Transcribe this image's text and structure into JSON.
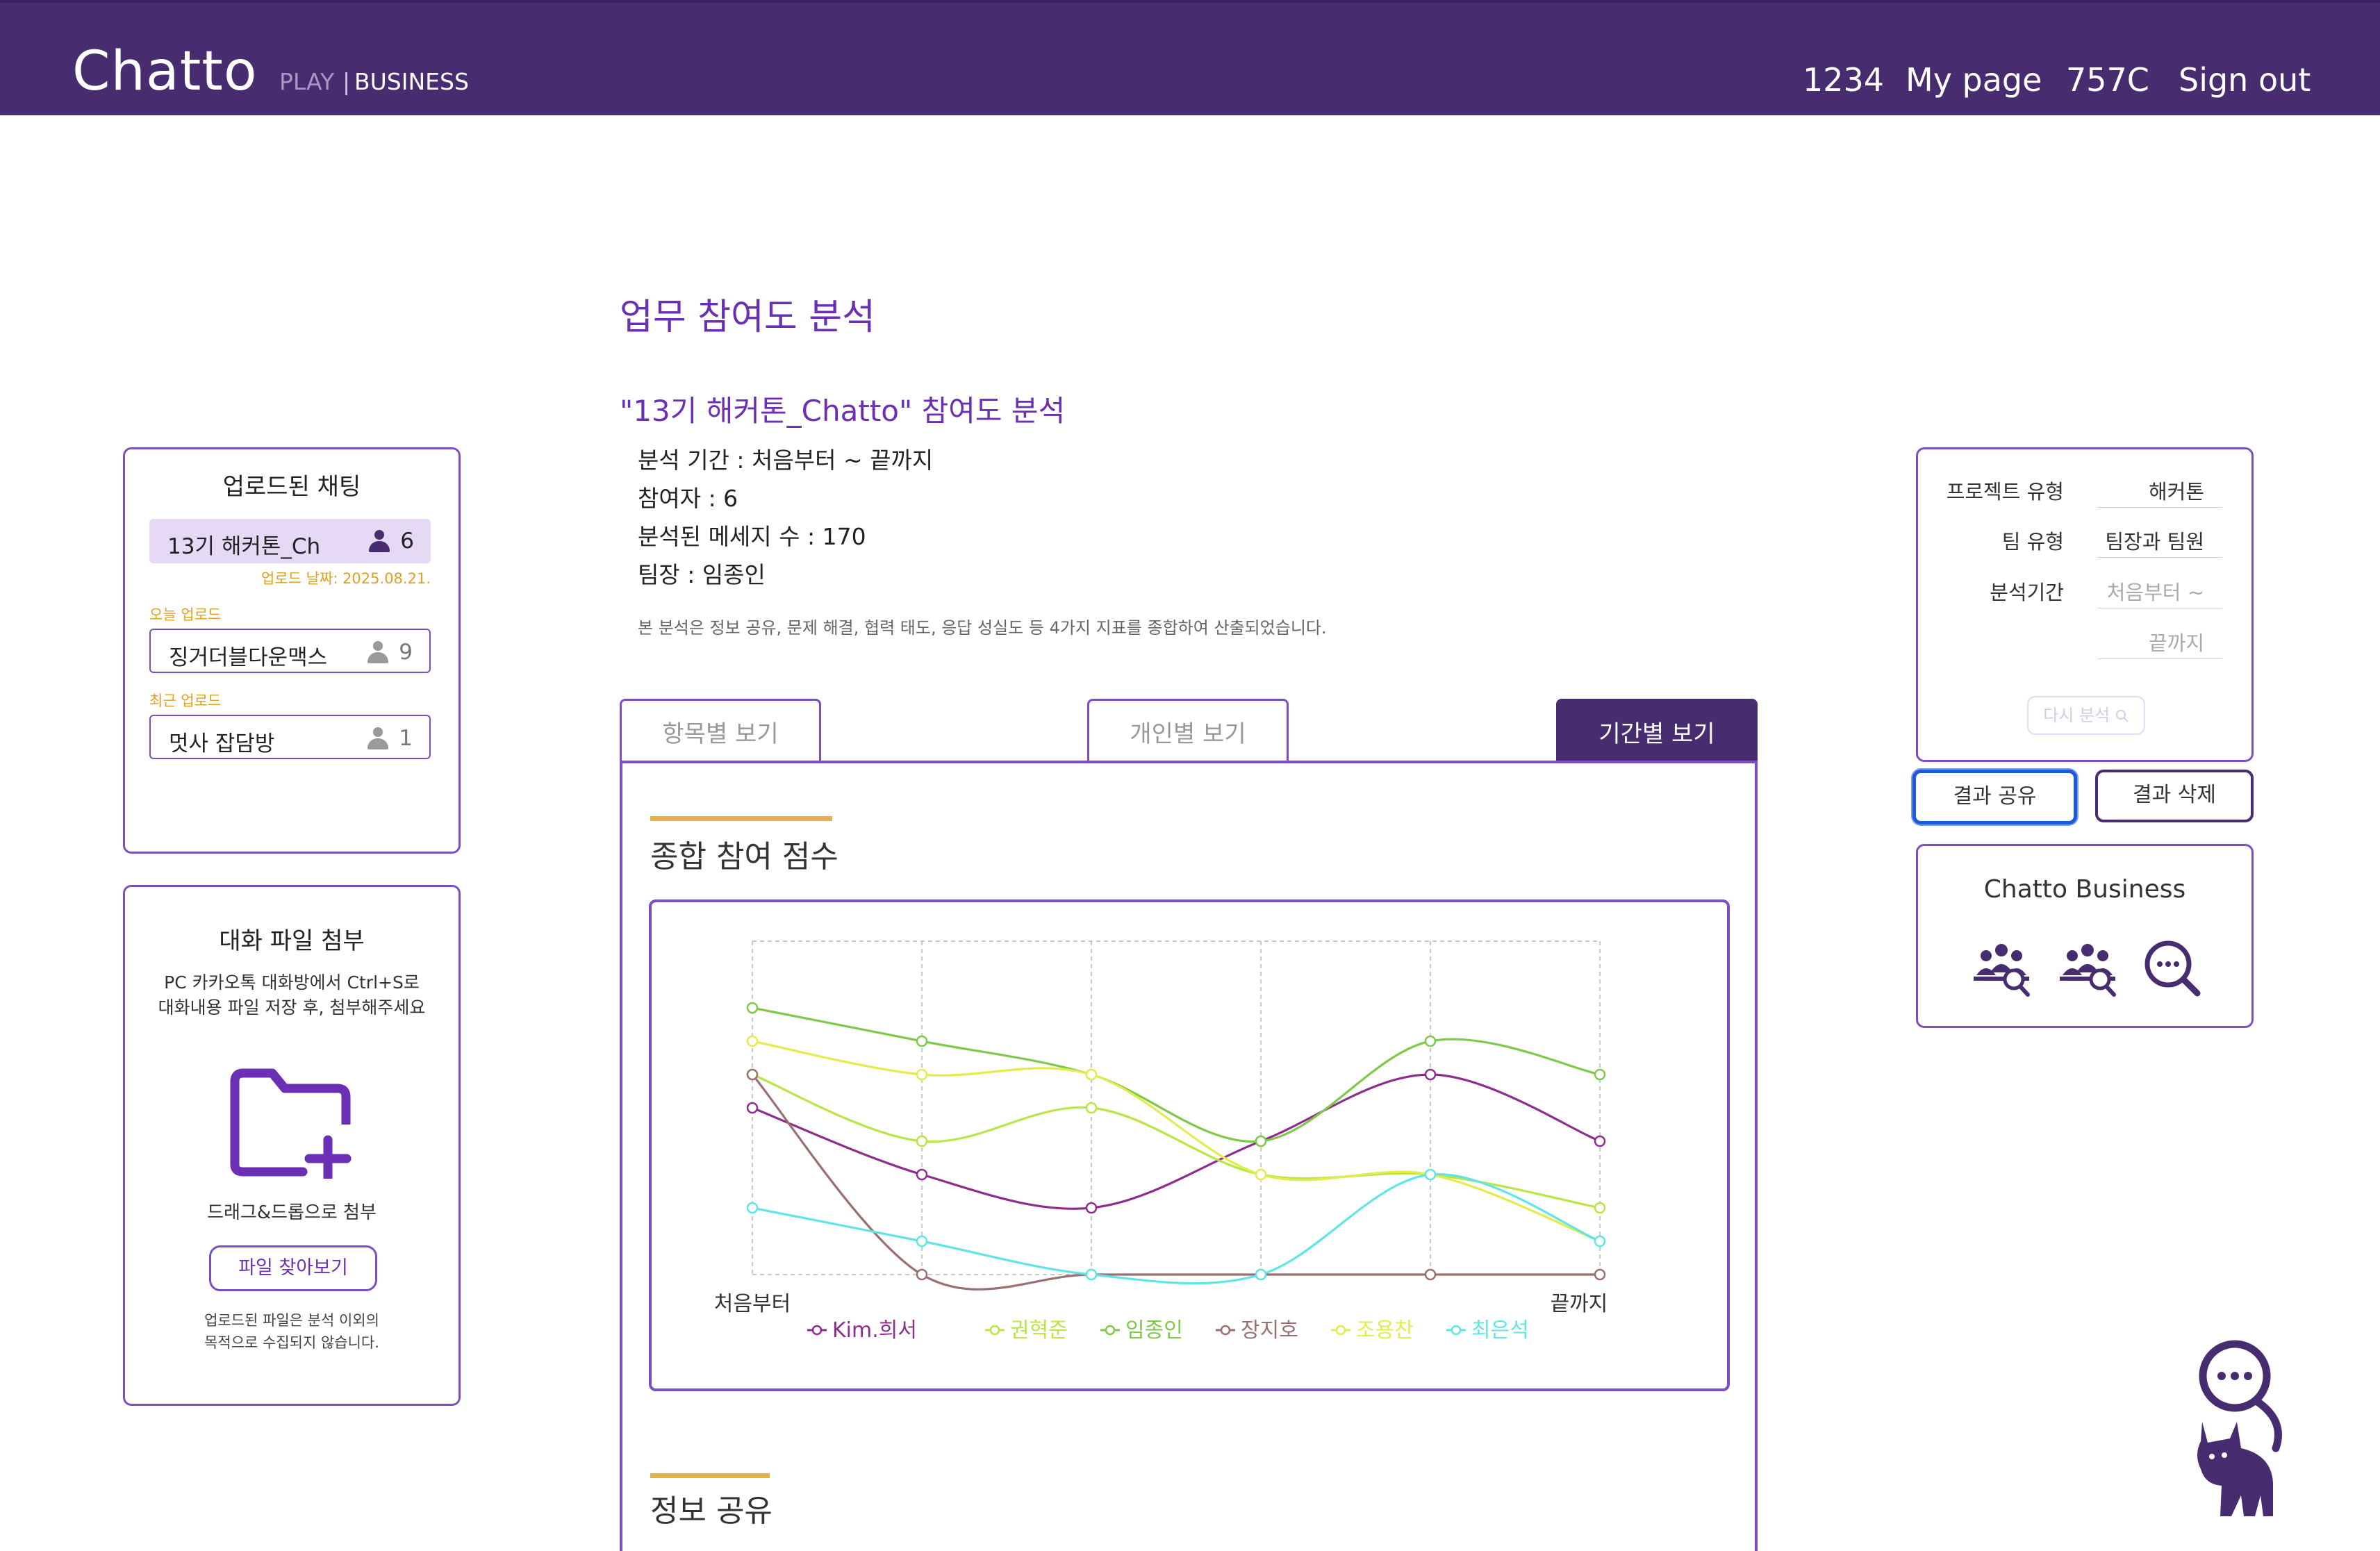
{
  "header": {
    "logo": "Chatto",
    "logo_play": "PLAY",
    "logo_separator": "|",
    "logo_business": "BUSINESS",
    "nav": [
      "1234",
      "My page",
      "757C",
      "Sign out"
    ]
  },
  "page": {
    "title": "업무 참여도 분석",
    "subtitle": "\"13기 해커톤_Chatto\" 참여도 분석",
    "meta": [
      "분석 기간 : 처음부터 ~ 끝까지",
      "참여자 : 6",
      "분석된 메세지 수 : 170",
      "팀장 : 임종인"
    ],
    "note": "본 분석은 정보 공유, 문제 해결, 협력 태도, 응답 성실도 등 4가지 지표를 종합하여 산출되었습니다."
  },
  "chats_panel": {
    "title": "업로드된 채팅",
    "active_chat": {
      "name": "13기 해커톤_Ch",
      "count": "6",
      "upload_date": "업로드 날짜: 2025.08.21."
    },
    "today_label": "오늘 업로드",
    "today_chat": {
      "name": "징거더블다운맥스",
      "count": "9"
    },
    "recent_label": "최근 업로드",
    "recent_chat": {
      "name": "멋사 잡담방",
      "count": "1"
    }
  },
  "upload_panel": {
    "title": "대화 파일 첨부",
    "desc_1": "PC 카카오톡 대화방에서 Ctrl+S로",
    "desc_2": "대화내용 파일 저장 후, 첨부해주세요",
    "folder_icon": "folder-plus-icon",
    "drag_text": "드래그&드롭으로 첨부",
    "button": "파일 찾아보기",
    "disclaimer_1": "업로드된 파일은 분석 이외의",
    "disclaimer_2": "목적으로 수집되지 않습니다."
  },
  "tabs": [
    {
      "label": "항목별 보기",
      "active": false
    },
    {
      "label": "개인별 보기",
      "active": false
    },
    {
      "label": "기간별 보기",
      "active": true
    }
  ],
  "sections": {
    "overall": "종합 참여 점수",
    "info_share": "정보 공유"
  },
  "chart_data": {
    "type": "line",
    "title": "종합 참여 점수",
    "x": [
      "처음부터",
      "",
      "",
      "",
      "",
      "끝까지"
    ],
    "grid": true,
    "legend_position": "bottom",
    "ylim": [
      0,
      100
    ],
    "series": [
      {
        "name": "Kim.희서",
        "color": "#8e2d8e",
        "values": [
          50,
          30,
          20,
          40,
          60,
          40
        ]
      },
      {
        "name": "권혁준",
        "color": "#b9e645",
        "values": [
          60,
          40,
          50,
          30,
          30,
          20
        ]
      },
      {
        "name": "임종인",
        "color": "#7ec94a",
        "values": [
          80,
          70,
          60,
          40,
          70,
          60
        ]
      },
      {
        "name": "장지호",
        "color": "#9a6f6f",
        "values": [
          60,
          0,
          0,
          0,
          0,
          0
        ]
      },
      {
        "name": "조용찬",
        "color": "#e2ec4d",
        "values": [
          70,
          60,
          60,
          30,
          30,
          10
        ]
      },
      {
        "name": "최은석",
        "color": "#5fe5e5",
        "values": [
          20,
          10,
          0,
          0,
          30,
          10
        ]
      }
    ]
  },
  "filter_panel": {
    "project_type_label": "프로젝트 유형",
    "project_type_value": "해커톤",
    "team_type_label": "팀 유형",
    "team_type_value": "팀장과 팀원",
    "period_label": "분석기간",
    "period_from": "처음부터 ~",
    "period_to": "끝까지",
    "reanalyze_button": "다시 분석",
    "reanalyze_icon": "search-icon"
  },
  "actions": {
    "share": "결과 공유",
    "delete": "결과 삭제"
  },
  "business_panel": {
    "title": "Chatto Business",
    "icons": [
      "team-search-icon",
      "team-search-icon",
      "chat-search-icon"
    ]
  },
  "mascot_icon": "cat-chat-search-icon"
}
